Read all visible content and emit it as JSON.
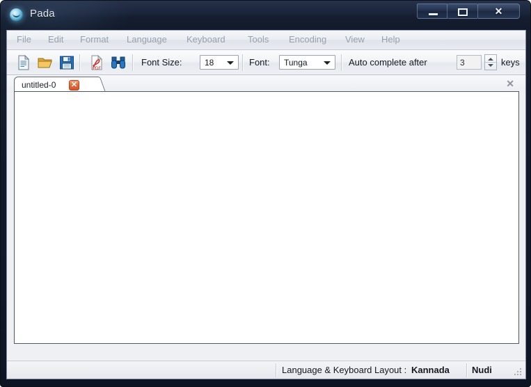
{
  "window": {
    "title": "Pada",
    "app_icon": "pada-app-icon",
    "controls": {
      "minimize": "minimize-button",
      "maximize": "maximize-button",
      "close": "close-button",
      "close_glyph": "✕"
    }
  },
  "menubar": {
    "items": [
      {
        "label": "File"
      },
      {
        "label": "Edit"
      },
      {
        "label": "Format"
      },
      {
        "label": "Language"
      },
      {
        "label": "Keyboard"
      },
      {
        "label": "Tools"
      },
      {
        "label": "Encoding"
      },
      {
        "label": "View"
      },
      {
        "label": "Help"
      }
    ]
  },
  "toolbar": {
    "icons": [
      {
        "name": "new-file-icon"
      },
      {
        "name": "open-folder-icon"
      },
      {
        "name": "save-icon"
      },
      {
        "name": "export-pdf-icon"
      },
      {
        "name": "find-binoculars-icon"
      }
    ],
    "font_size_label": "Font Size:",
    "font_size_value": "18",
    "font_label": "Font:",
    "font_value": "Tunga",
    "autocomplete_label": "Auto complete after",
    "autocomplete_value": "3",
    "autocomplete_suffix": "keys"
  },
  "tabs": {
    "items": [
      {
        "label": "untitled-0",
        "close_glyph": "✕"
      }
    ],
    "bar_close_glyph": "✕"
  },
  "editor": {
    "content": ""
  },
  "statusbar": {
    "label": "Language & Keyboard Layout :",
    "language": "Kannada",
    "layout": "Nudi"
  },
  "colors": {
    "titlebar": "#1a2338",
    "accent_tab_close": "#d4542c",
    "client_bg": "#eef0f4",
    "editor_bg": "#ffffff"
  }
}
